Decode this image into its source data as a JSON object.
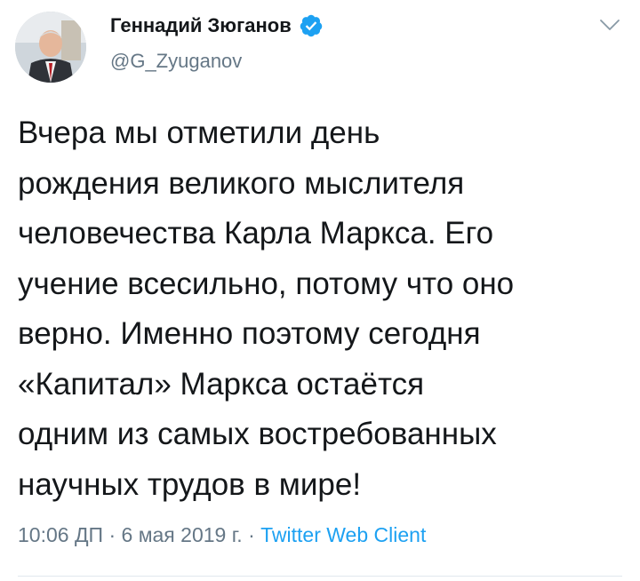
{
  "tweet": {
    "author": {
      "name": "Геннадий Зюганов",
      "handle": "@G_Zyuganov",
      "verified_icon": "verified-badge-icon",
      "avatar_icon": "user-avatar-photo"
    },
    "menu_icon": "chevron-down-icon",
    "text_lines": [
      "Вчера мы отметили день",
      "рождения великого мыслителя",
      "человечества Карла Маркса. Его",
      "учение всесильно, потому что оно",
      "верно. Именно поэтому сегодня",
      "«Капитал» Маркса остаётся",
      "одним из самых востребованных",
      "научных трудов в мире!"
    ],
    "meta": {
      "time": "10:06 ДП",
      "separator": " · ",
      "date": "6 мая 2019 г.",
      "separator2": " · ",
      "source": "Twitter Web Client"
    }
  },
  "colors": {
    "text": "#14171a",
    "secondary": "#657786",
    "link": "#1da1f2",
    "divider": "#e1e8ed"
  }
}
